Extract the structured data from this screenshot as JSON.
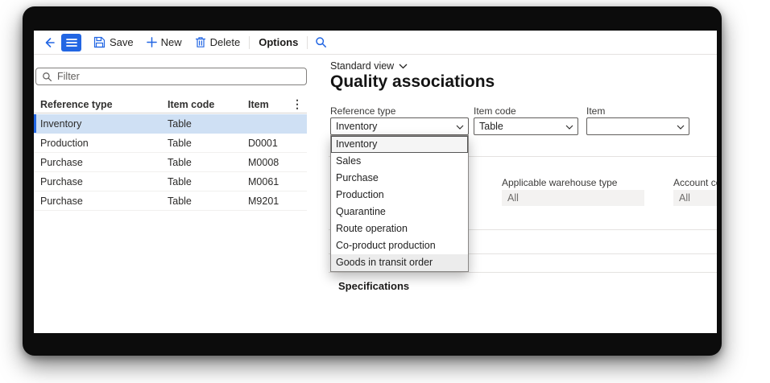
{
  "toolbar": {
    "save_label": "Save",
    "new_label": "New",
    "delete_label": "Delete",
    "options_label": "Options"
  },
  "left_panel": {
    "filter_placeholder": "Filter",
    "columns": {
      "reference_type": "Reference type",
      "item_code": "Item code",
      "item": "Item"
    },
    "rows": [
      {
        "reference_type": "Inventory",
        "item_code": "Table",
        "item": ""
      },
      {
        "reference_type": "Production",
        "item_code": "Table",
        "item": "D0001"
      },
      {
        "reference_type": "Purchase",
        "item_code": "Table",
        "item": "M0008"
      },
      {
        "reference_type": "Purchase",
        "item_code": "Table",
        "item": "M0061"
      },
      {
        "reference_type": "Purchase",
        "item_code": "Table",
        "item": "M9201"
      }
    ],
    "selected_row_index": 0
  },
  "right_panel": {
    "view_selector": "Standard view",
    "title": "Quality associations",
    "fields": {
      "reference_type": {
        "label": "Reference type",
        "value": "Inventory"
      },
      "item_code": {
        "label": "Item code",
        "value": "Table"
      },
      "item": {
        "label": "Item",
        "value": ""
      },
      "applicable_warehouse_type": {
        "label": "Applicable warehouse type",
        "value": "All"
      },
      "account_code": {
        "label": "Account code",
        "value": "All"
      }
    },
    "dropdown_options": [
      "Inventory",
      "Sales",
      "Purchase",
      "Production",
      "Quarantine",
      "Route operation",
      "Co-product production",
      "Goods in transit order"
    ],
    "dropdown_selected": "Inventory",
    "dropdown_hovered": "Goods in transit order",
    "sections": {
      "specifications": "Specifications"
    }
  },
  "icons": {
    "more_vertical": "⋮"
  },
  "colors": {
    "accent": "#2266E3",
    "selected_row_bg": "#cfe0f4",
    "disabled_field_bg": "#f3f2f1"
  }
}
